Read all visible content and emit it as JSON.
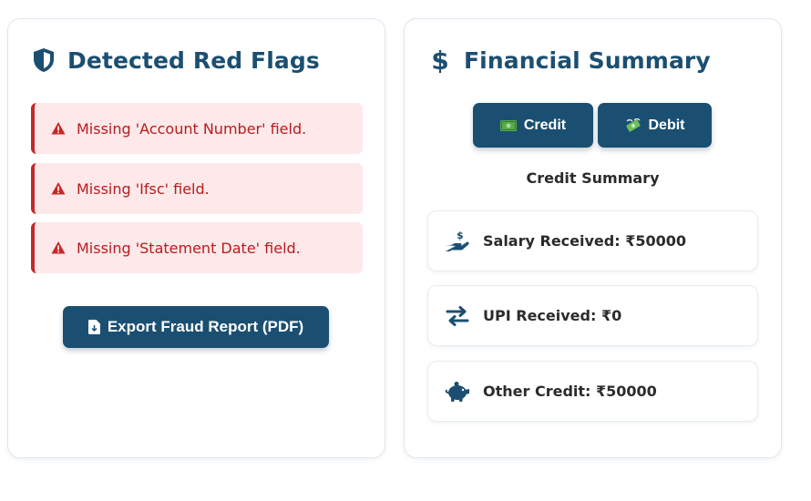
{
  "colors": {
    "primary": "#1b4f72",
    "danger": "#c62828",
    "danger_bg": "#fde8ea"
  },
  "red_flags": {
    "title": "Detected Red Flags",
    "icon": "shield-icon",
    "items": [
      {
        "text": "Missing 'Account Number' field.",
        "icon": "warning-icon"
      },
      {
        "text": "Missing 'Ifsc' field.",
        "icon": "warning-icon"
      },
      {
        "text": "Missing 'Statement Date' field.",
        "icon": "warning-icon"
      }
    ],
    "export_label": "Export Fraud Report (PDF)",
    "export_icon": "file-download-icon"
  },
  "financial_summary": {
    "title": "Financial Summary",
    "icon": "dollar-icon",
    "tabs": [
      {
        "label": "Credit",
        "icon": "money-bill-icon"
      },
      {
        "label": "Debit",
        "icon": "flying-money-icon"
      }
    ],
    "subheading": "Credit Summary",
    "items": [
      {
        "label": "Salary Received: ₹50000",
        "icon": "hand-holding-dollar-icon"
      },
      {
        "label": "UPI Received: ₹0",
        "icon": "exchange-arrows-icon"
      },
      {
        "label": "Other Credit: ₹50000",
        "icon": "piggy-bank-icon"
      }
    ]
  }
}
